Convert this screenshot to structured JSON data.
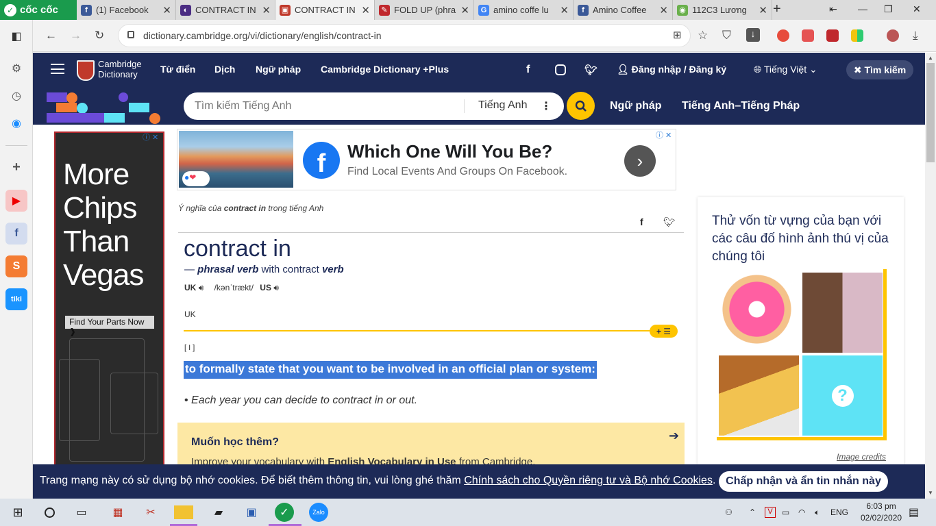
{
  "browser": {
    "brand": "cốc cốc",
    "tabs": [
      {
        "title": "(1) Facebook",
        "fav": "f",
        "color": "#3b5998"
      },
      {
        "title": "CONTRACT IN",
        "fav": "◐",
        "color": "#4b2d83"
      },
      {
        "title": "CONTRACT IN",
        "fav": "▣",
        "color": "#c0392b"
      },
      {
        "title": "FOLD UP (phra",
        "fav": "✎",
        "color": "#c0282d"
      },
      {
        "title": "amino coffe lu",
        "fav": "G",
        "color": "#4285f4"
      },
      {
        "title": "Amino Coffee",
        "fav": "f",
        "color": "#3b5998"
      },
      {
        "title": "112C3 Lương",
        "fav": "◉",
        "color": "#6ab04c"
      }
    ],
    "url": "dictionary.cambridge.org/vi/dictionary/english/contract-in"
  },
  "header": {
    "logo_line1": "Cambridge",
    "logo_line2": "Dictionary",
    "nav": [
      "Từ điển",
      "Dịch",
      "Ngữ pháp",
      "Cambridge Dictionary +Plus"
    ],
    "login": "Đăng nhập / Đăng ký",
    "language": "Tiếng Việt",
    "search_btn": "Tìm kiếm"
  },
  "search": {
    "placeholder": "Tìm kiếm Tiếng Anh",
    "lang": "Tiếng Anh",
    "links": [
      "Ngữ pháp",
      "Tiếng Anh–Tiếng Pháp"
    ]
  },
  "side_ad": {
    "text_lines": [
      "More",
      "Chips",
      "Than",
      "Vegas"
    ],
    "button": "Find Your Parts Now ❱"
  },
  "top_ad": {
    "title": "Which One Will You Be?",
    "subtitle": "Find Local Events And Groups On Facebook."
  },
  "entry": {
    "breadcrumb_pre": "Ý nghĩa của ",
    "breadcrumb_word": "contract in",
    "breadcrumb_post": " trong tiếng Anh",
    "headword": "contract in",
    "pos_prefix": "— ",
    "pos": "phrasal verb",
    "pos_with": " with contract ",
    "pos_verb": "verb",
    "uk": "UK",
    "us": "US",
    "ipa": "/kənˈtrækt/",
    "region": "UK",
    "grammar": "[ I ]",
    "definition": "to formally state that you want to be involved in an official plan or system:",
    "example": "Each year you can decide to contract in or out."
  },
  "learn_more": {
    "title": "Muốn học thêm?",
    "body_pre": "Improve your vocabulary with ",
    "body_bold": "English Vocabulary in Use",
    "body_post": " from Cambridge."
  },
  "quiz": {
    "title": "Thử vốn từ vựng của bạn với các câu đố hình ảnh thú vị của chúng tôi",
    "credits": "Image credits"
  },
  "cookie": {
    "text": "Trang mạng này có sử dụng bộ nhớ cookies. Để biết thêm thông tin, vui lòng ghé thăm ",
    "link": "Chính sách cho Quyền riêng tư và Bộ nhớ Cookies",
    "end": ".",
    "button": "Chấp nhận và ẩn tin nhắn này"
  },
  "taskbar": {
    "lang": "ENG",
    "time": "6:03 pm",
    "date": "02/02/2020"
  }
}
